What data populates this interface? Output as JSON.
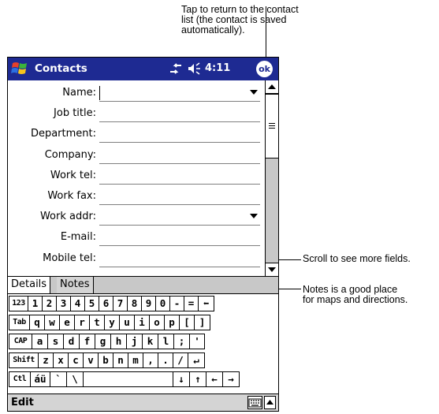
{
  "callouts": {
    "ok_tip": "Tap to return to the contact\nlist (the contact is saved\nautomatically).",
    "scroll_tip": "Scroll to see more fields.",
    "notes_tip": "Notes is a good place\nfor maps and directions."
  },
  "titlebar": {
    "title": "Contacts",
    "time": "4:11",
    "ok_label": "ok",
    "background": "#1e2a92"
  },
  "form": {
    "fields": [
      {
        "label": "Name:",
        "value": "",
        "has_dropdown": true,
        "focused": true
      },
      {
        "label": "Job title:",
        "value": ""
      },
      {
        "label": "Department:",
        "value": ""
      },
      {
        "label": "Company:",
        "value": ""
      },
      {
        "label": "Work tel:",
        "value": ""
      },
      {
        "label": "Work fax:",
        "value": ""
      },
      {
        "label": "Work addr:",
        "value": "",
        "has_dropdown": true
      },
      {
        "label": "E-mail:",
        "value": ""
      },
      {
        "label": "Mobile tel:",
        "value": ""
      }
    ]
  },
  "tabs": {
    "details": "Details",
    "notes": "Notes"
  },
  "keyboard": {
    "rows": [
      [
        "123",
        "1",
        "2",
        "3",
        "4",
        "5",
        "6",
        "7",
        "8",
        "9",
        "0",
        "-",
        "=",
        "⬅"
      ],
      [
        "Tab",
        "q",
        "w",
        "e",
        "r",
        "t",
        "y",
        "u",
        "i",
        "o",
        "p",
        "[",
        "]"
      ],
      [
        "CAP",
        "a",
        "s",
        "d",
        "f",
        "g",
        "h",
        "j",
        "k",
        "l",
        ";",
        "'"
      ],
      [
        "Shift",
        "z",
        "x",
        "c",
        "v",
        "b",
        "n",
        "m",
        ",",
        ".",
        "/",
        "↵"
      ],
      [
        "Ctl",
        "áü",
        "`",
        "\\",
        " ",
        "↓",
        "↑",
        "←",
        "→"
      ]
    ]
  },
  "cmdbar": {
    "edit": "Edit"
  }
}
